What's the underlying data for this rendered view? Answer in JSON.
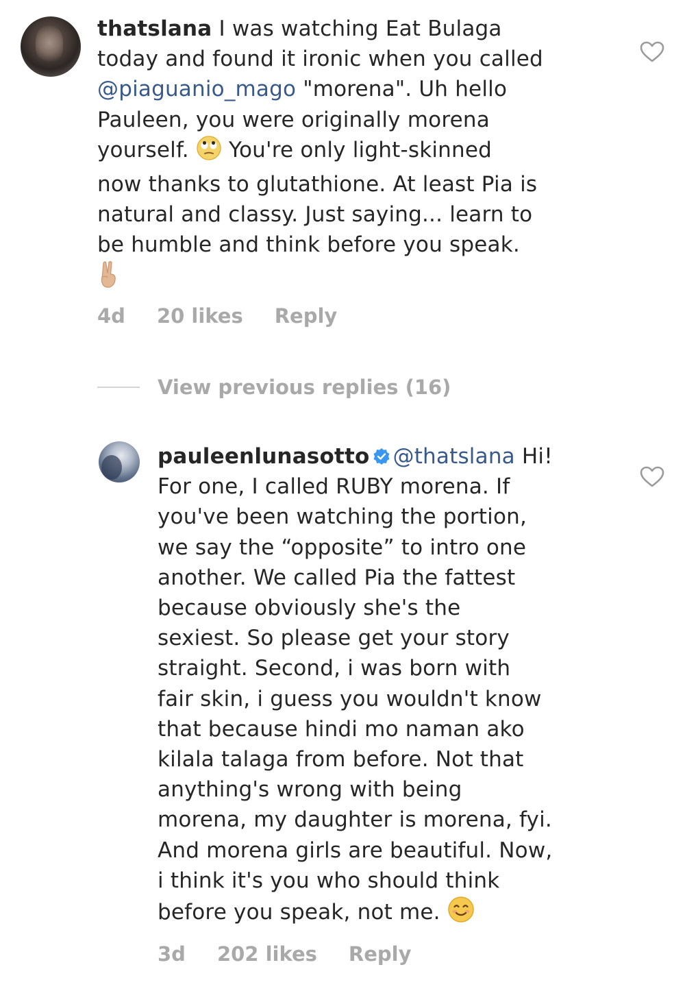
{
  "comments": [
    {
      "username": "thatslana",
      "lines": {
        "l1": "I was watching Eat Bulaga",
        "l2": "today and found it ironic when you called",
        "l3_mention": "@piaguanio_mago",
        "l3_rest": " \"morena\". Uh hello",
        "l4": "Pauleen, you were originally morena",
        "l5a": "yourself. ",
        "l5b": " You're only light-skinned",
        "l6": "now thanks to glutathione. At least Pia is",
        "l7": "natural and classy. Just saying... learn to",
        "l8": "be humble and think before you speak."
      },
      "emojis": [
        "rolling-eyes-emoji",
        "victory-hand-emoji"
      ],
      "age": "4d",
      "likes": "20 likes",
      "reply_label": "Reply"
    },
    {
      "username": "pauleenlunasotto",
      "verified": true,
      "lines": {
        "l1_mention": "@thatslana",
        "l1_rest": " Hi!",
        "l2": "For one, I called RUBY morena. If",
        "l3": "you've been watching the portion,",
        "l4": "we say the “opposite” to intro one",
        "l5": "another. We called Pia the fattest",
        "l6": "because obviously she's the",
        "l7": "sexiest. So please get your story",
        "l8": "straight. Second, i was born with",
        "l9": "fair skin, i guess you wouldn't know",
        "l10": "that because hindi mo naman ako",
        "l11": "kilala talaga from before. Not that",
        "l12": "anything's wrong with being",
        "l13": "morena, my daughter is morena, fyi.",
        "l14": "And morena girls are beautiful. Now,",
        "l15": "i think it's you who should think",
        "l16": "before you speak, not me. "
      },
      "emojis": [
        "smiling-face-emoji"
      ],
      "age": "3d",
      "likes": "202 likes",
      "reply_label": "Reply"
    }
  ],
  "view_previous_replies": "View previous replies (16)",
  "colors": {
    "text": "#262626",
    "meta": "#a9a9a9",
    "mention": "#385a8a",
    "verified_blue": "#3897f0"
  }
}
